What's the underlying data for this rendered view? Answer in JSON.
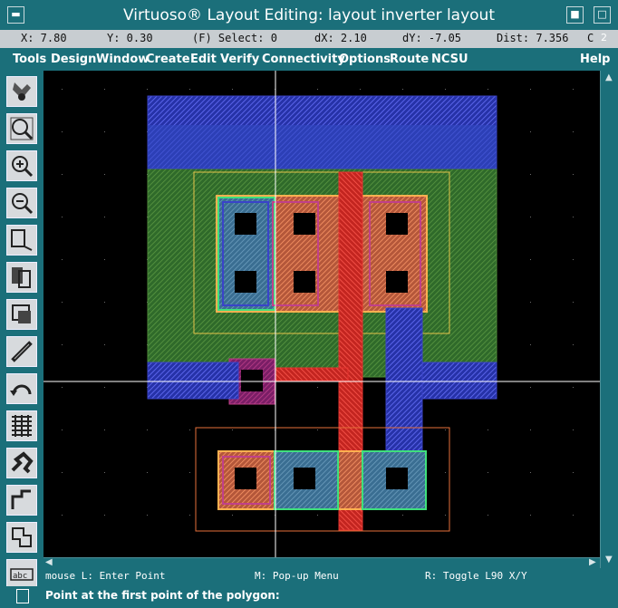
{
  "window": {
    "title": "Virtuoso® Layout Editing: layout inverter layout",
    "right_badge": "2"
  },
  "status": {
    "x": "X: 7.80",
    "y": "Y: 0.30",
    "select": "(F) Select: 0",
    "dx": "dX: 2.10",
    "dy": "dY: -7.05",
    "dist": "Dist: 7.356",
    "trunc": "C"
  },
  "menu": [
    "Tools",
    "Design",
    "Window",
    "Create",
    "Edit",
    "Verify",
    "Connectivity",
    "Options",
    "Route",
    "NCSU",
    "Help"
  ],
  "toolbar": {
    "icons": [
      "save-icon",
      "zoom-fit-icon",
      "zoom-in-icon",
      "zoom-out-icon",
      "stretch-icon",
      "copy-icon",
      "move-icon",
      "ruler-icon",
      "undo-icon",
      "pattern-icon",
      "path-icon",
      "rectangle-icon",
      "polygon-icon",
      "label-icon"
    ]
  },
  "mouse_help": {
    "left": "mouse L: Enter Point",
    "middle": "M: Pop-up Menu",
    "right": "R: Toggle L90 X/Y"
  },
  "prompt": "Point at the first point of the polygon:",
  "colors": {
    "background": "#1b6f7a",
    "canvas": "#000000",
    "metal1": "#3a43c9",
    "poly": "#e4332f",
    "nwell": "#4e8c3a",
    "pactive": "#ffb050",
    "nactive": "#3fe07c"
  }
}
